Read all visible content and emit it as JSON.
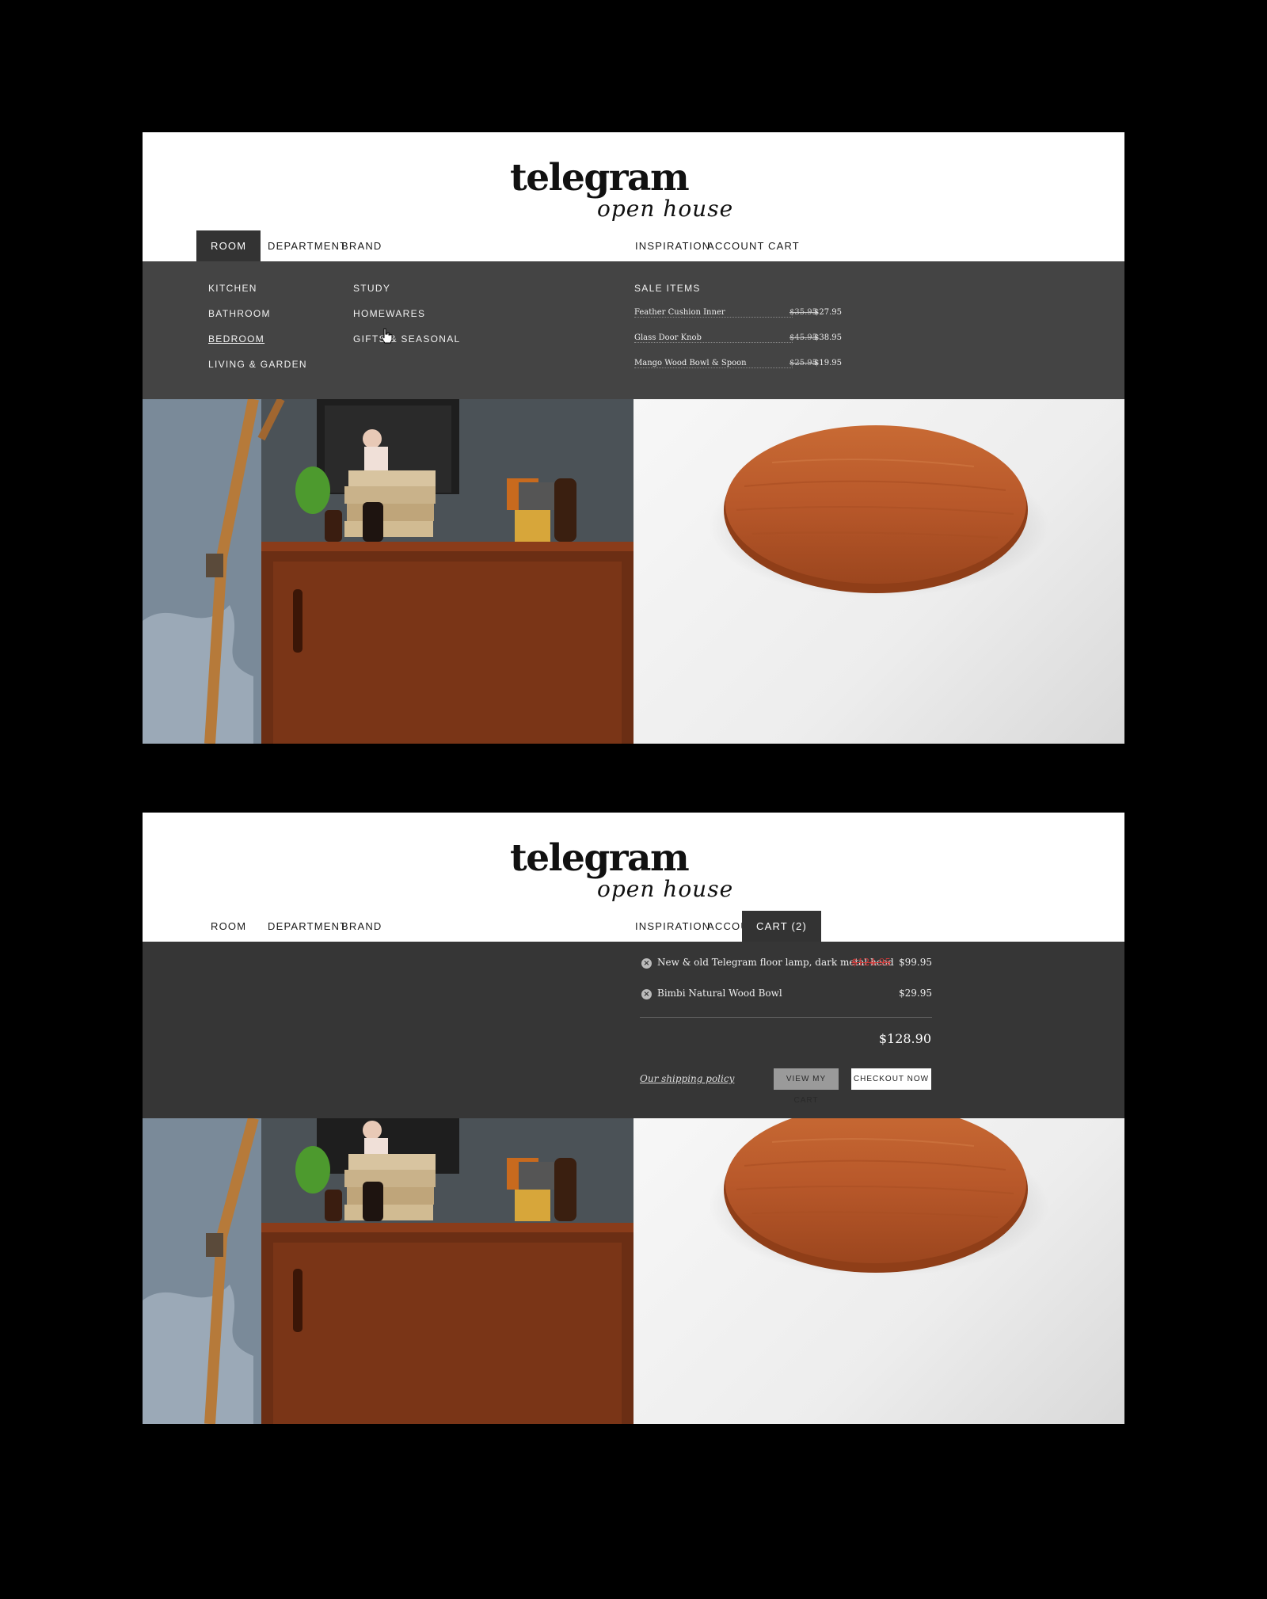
{
  "panel1": {
    "logo": {
      "wordmark": "telegram",
      "tagline": "open house"
    },
    "nav_left": [
      "ROOM",
      "DEPARTMENT",
      "BRAND"
    ],
    "nav_right": [
      "INSPIRATION",
      "ACCOUNT",
      "CART"
    ],
    "active_nav": "ROOM",
    "room_menu": {
      "col1": [
        "KITCHEN",
        "BATHROOM",
        "BEDROOM",
        "LIVING & GARDEN"
      ],
      "col2": [
        "STUDY",
        "HOMEWARES",
        "GIFTS & SEASONAL"
      ],
      "hovered": "BEDROOM"
    },
    "sale": {
      "title": "SALE ITEMS",
      "items": [
        {
          "name": "Feather Cushion Inner",
          "old_price": "$35.95",
          "price": "$27.95"
        },
        {
          "name": "Glass Door Knob",
          "old_price": "$45.95",
          "price": "$38.95"
        },
        {
          "name": "Mango Wood Bowl & Spoon",
          "old_price": "$25.95",
          "price": "$19.95"
        }
      ]
    }
  },
  "panel2": {
    "logo": {
      "wordmark": "telegram",
      "tagline": "open house"
    },
    "nav_left": [
      "ROOM",
      "DEPARTMENT",
      "BRAND"
    ],
    "nav_right": [
      "INSPIRATION",
      "ACCOUNT",
      "CART (2)"
    ],
    "active_nav": "CART (2)",
    "cart": {
      "items": [
        {
          "title": "New & old Telegram floor lamp, dark metal head",
          "old_price": "$124.95",
          "price": "$99.95"
        },
        {
          "title": "Bimbi Natural Wood Bowl",
          "old_price": "",
          "price": "$29.95"
        }
      ],
      "total": "$128.90",
      "shipping_link": "Our shipping policy",
      "view_cart_label": "VIEW MY CART",
      "checkout_label": "CHECKOUT NOW"
    }
  },
  "colors": {
    "dropdown_bg": "#444444",
    "cart_bg": "#363636",
    "active_tab": "#333333",
    "sale_red": "#d63a3a",
    "wood": "#b8582a"
  },
  "icons": [
    "remove-item-icon",
    "pointer-hand-cursor-icon"
  ]
}
